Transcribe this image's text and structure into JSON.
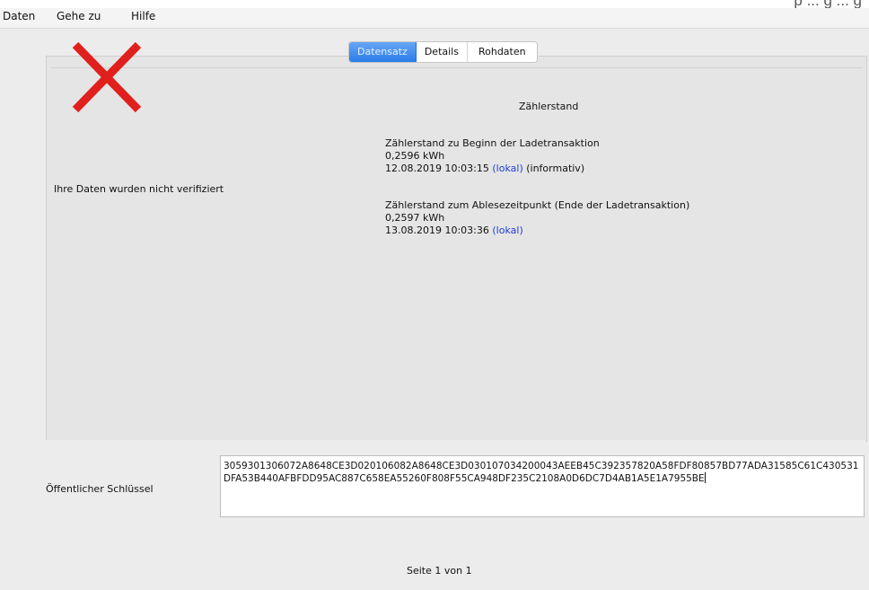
{
  "top_crop_text": "p ... g ... g",
  "menu": {
    "items": [
      "Daten",
      "Gehe zu",
      "Hilfe"
    ]
  },
  "tabs": {
    "items": [
      "Datensatz",
      "Details",
      "Rohdaten"
    ],
    "active": "Datensatz"
  },
  "verification": {
    "icon": "red-x-icon",
    "color": "#e0201c",
    "message": "Ihre Daten wurden nicht verifiziert"
  },
  "meter": {
    "title": "Zählerstand",
    "start": {
      "label": "Zählerstand zu Beginn der Ladetransaktion",
      "value": "0,2596 kWh",
      "timestamp": "12.08.2019 10:03:15",
      "source_link": "(lokal)",
      "note": "(informativ)"
    },
    "end": {
      "label": "Zählerstand zum Ablesezeitpunkt (Ende der Ladetransaktion)",
      "value": "0,2597 kWh",
      "timestamp": "13.08.2019 10:03:36",
      "source_link": "(lokal)"
    }
  },
  "public_key": {
    "label": "Öffentlicher Schlüssel",
    "value": "3059301306072A8648CE3D020106082A8648CE3D030107034200043AEEB45C392357820A58FDF80857BD77ADA31585C61C430531DFA53B440AFBFDD95AC887C658EA55260F808F55CA948DF235C2108A0D6DC7D4AB1A5E1A7955BE"
  },
  "pagination": {
    "text": "Seite 1 von 1"
  }
}
